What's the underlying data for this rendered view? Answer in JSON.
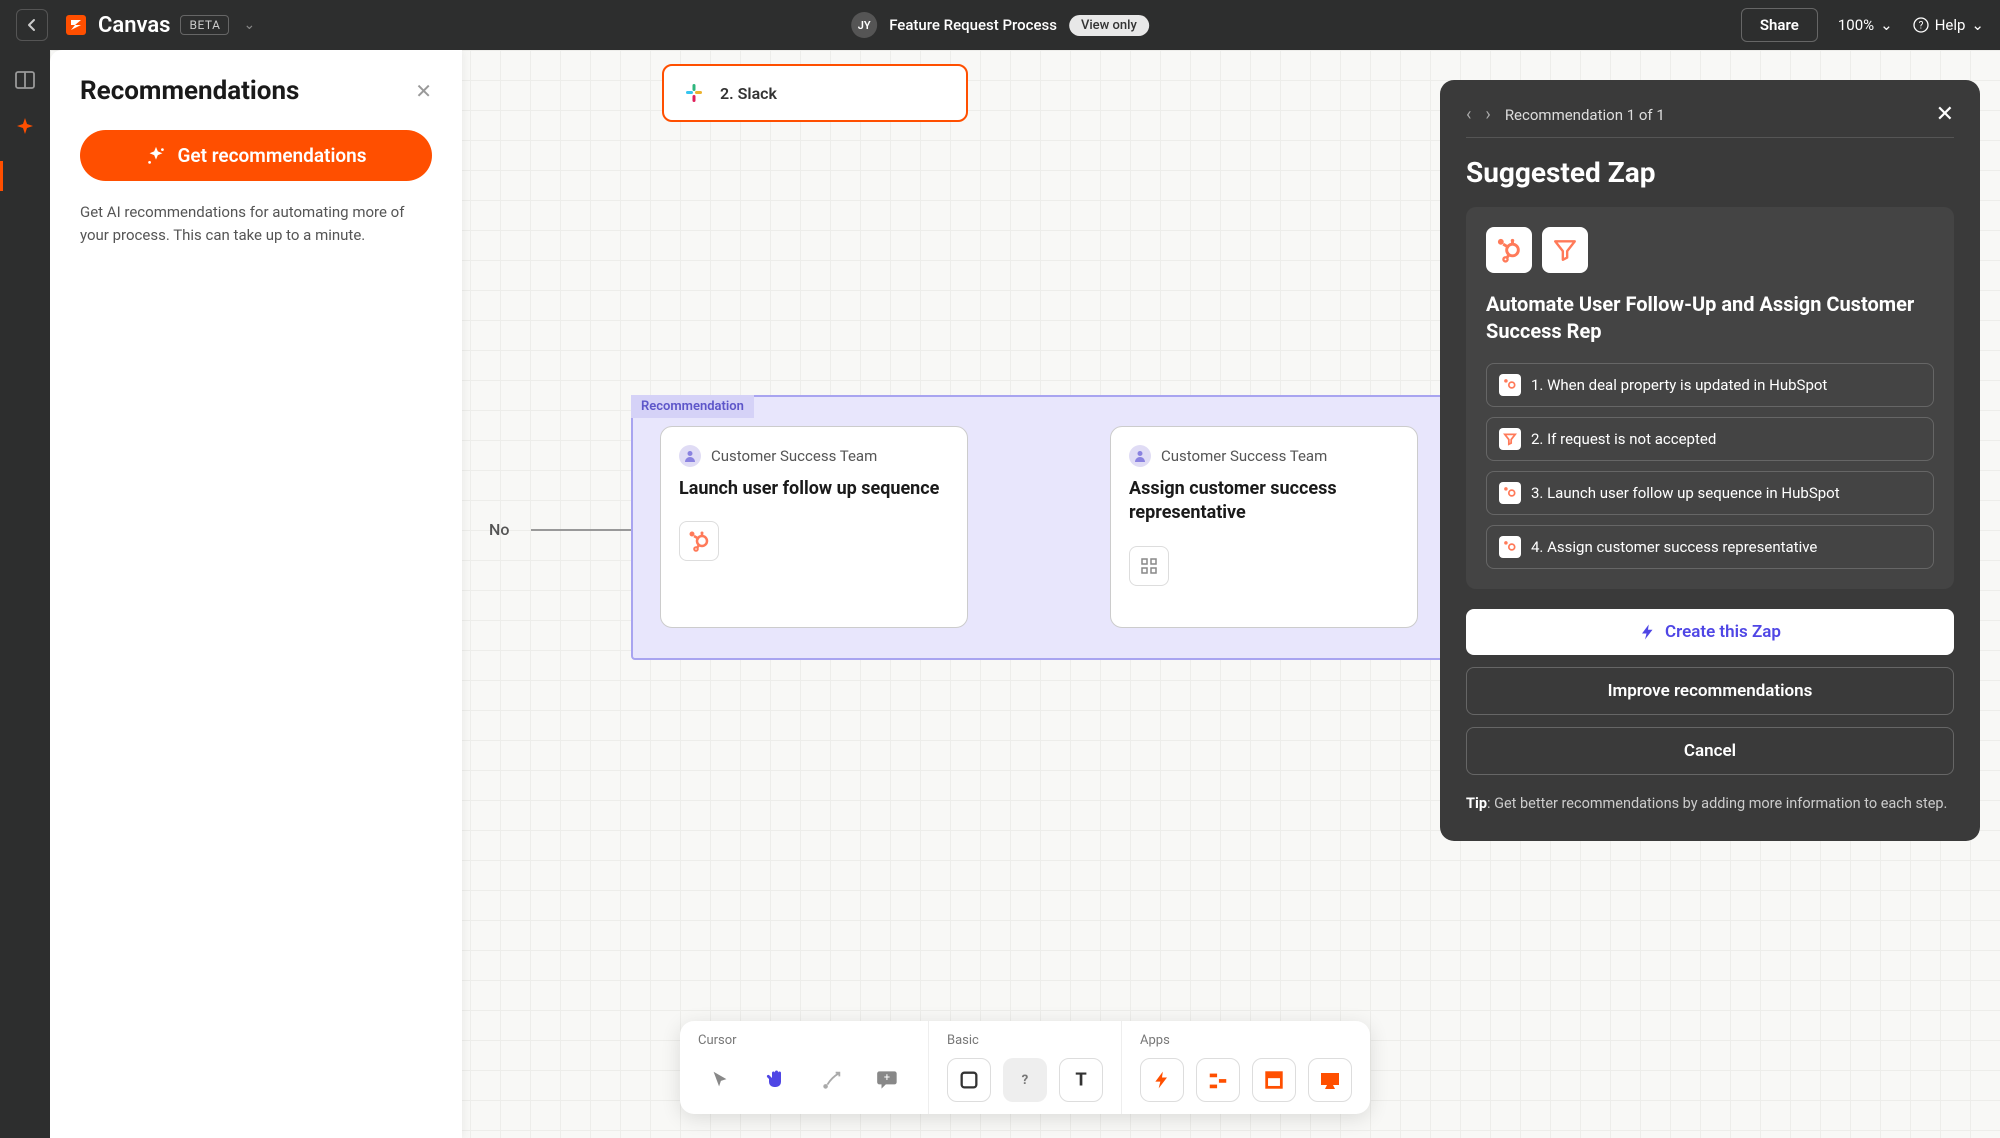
{
  "topbar": {
    "app_name": "Canvas",
    "beta": "BETA",
    "avatar_initials": "JY",
    "doc_title": "Feature Request Process",
    "view_only": "View only",
    "share": "Share",
    "zoom": "100%",
    "help": "Help"
  },
  "sidebar": {
    "title": "Recommendations",
    "button": "Get recommendations",
    "hint": "Get AI recommendations for automating more of your process. This can take up to a minute."
  },
  "canvas": {
    "slack_node": "2. Slack",
    "rec_label": "Recommendation",
    "edge_no": "No",
    "card1": {
      "team": "Customer Success Team",
      "title": "Launch user follow up sequence"
    },
    "card2": {
      "team": "Customer Success Team",
      "title": "Assign customer success representative"
    }
  },
  "zap_panel": {
    "counter": "Recommendation 1 of 1",
    "title": "Suggested Zap",
    "subtitle": "Automate User Follow-Up and Assign Customer Success Rep",
    "steps": [
      "1. When deal property is updated in HubSpot",
      "2. If request is not accepted",
      "3. Launch user follow up sequence in HubSpot",
      "4. Assign customer success representative"
    ],
    "create": "Create this Zap",
    "improve": "Improve recommendations",
    "cancel": "Cancel",
    "tip_bold": "Tip",
    "tip": ": Get better recommendations by adding more information to each step."
  },
  "toolbar": {
    "cursor": "Cursor",
    "basic": "Basic",
    "apps": "Apps"
  }
}
